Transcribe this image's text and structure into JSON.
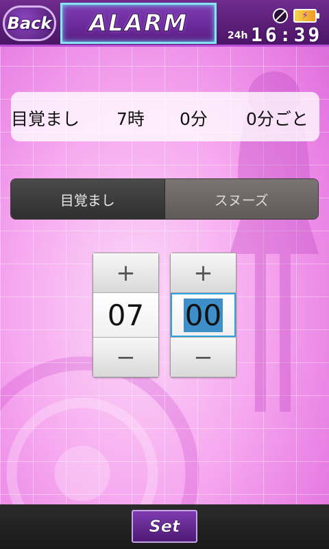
{
  "header": {
    "back_label": "Back",
    "title": "ALARM",
    "clock_mode": "24h",
    "time": "16:39"
  },
  "summary": {
    "label": "目覚まし",
    "hour": "7時",
    "minute": "0分",
    "snooze": "0分ごと"
  },
  "tabs": [
    {
      "label": "目覚まし",
      "active": true
    },
    {
      "label": "スヌーズ",
      "active": false
    }
  ],
  "pickers": {
    "hour": {
      "value": "07",
      "plus": "+",
      "minus": "−"
    },
    "minute": {
      "value": "00",
      "plus": "+",
      "minus": "−",
      "focused": true
    }
  },
  "bottom": {
    "set_label": "Set"
  },
  "colors": {
    "accent_purple": "#6f2c8e",
    "focus_blue": "#2e9fe0",
    "background_pink": "#f6a8ef"
  }
}
